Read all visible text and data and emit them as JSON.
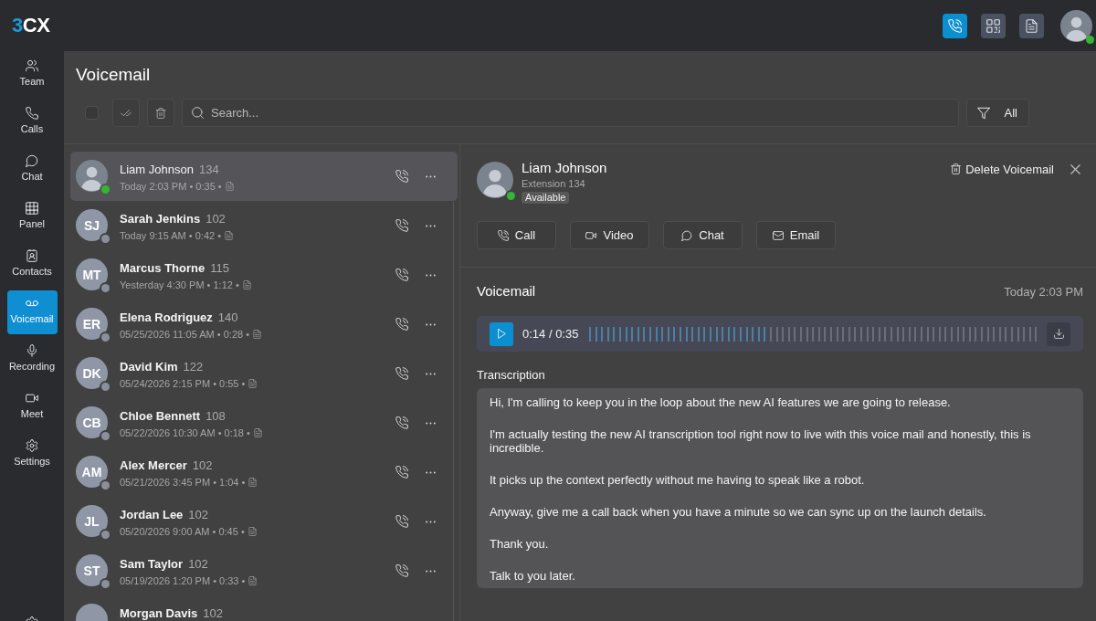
{
  "top_bar": {
    "logo": "3CX",
    "actions": [
      {
        "kind": "phone",
        "selected": true
      },
      {
        "kind": "qr",
        "selected": false
      },
      {
        "kind": "document",
        "selected": false
      }
    ],
    "user": {
      "color": "#33b633"
    }
  },
  "sidebar": {
    "items": [
      {
        "kind": "team",
        "label": "Team",
        "selected": false
      },
      {
        "kind": "calls",
        "label": "Calls",
        "selected": false
      },
      {
        "kind": "chat",
        "label": "Chat",
        "selected": false
      },
      {
        "kind": "panel",
        "label": "Panel",
        "selected": false
      },
      {
        "kind": "contacts",
        "label": "Contacts",
        "selected": false
      },
      {
        "kind": "voicemail",
        "label": "Voicemail",
        "selected": true
      },
      {
        "kind": "recording",
        "label": "Recording",
        "selected": false
      },
      {
        "kind": "meet",
        "label": "Meet",
        "selected": false
      },
      {
        "kind": "settings",
        "label": "Settings",
        "selected": false
      }
    ]
  },
  "page": {
    "title": "Voicemail"
  },
  "toolbar": {
    "select_all": {
      "checked": false
    },
    "search": {
      "placeholder": "Search..."
    },
    "filter": {
      "label": "All"
    }
  },
  "voicemails": [
    {
      "kind": "photo",
      "name": "Liam Johnson",
      "extension": "134",
      "meta": "Today 2:03 PM • 0:35 •",
      "selected": true,
      "unread": false,
      "color": "#33b633"
    },
    {
      "kind": "initials",
      "initials": "SJ",
      "name": "Sarah Jenkins",
      "extension": "102",
      "meta": "Today 9:15 AM • 0:42 •",
      "selected": false,
      "unread": true,
      "color": "#8a909b"
    },
    {
      "kind": "initials",
      "initials": "MT",
      "name": "Marcus Thorne",
      "extension": "115",
      "meta": "Yesterday 4:30 PM • 1:12 •",
      "selected": false,
      "unread": true,
      "color": "#8a909b"
    },
    {
      "kind": "initials",
      "initials": "ER",
      "name": "Elena Rodriguez",
      "extension": "140",
      "meta": "05/25/2026 11:05 AM • 0:28 •",
      "selected": false,
      "unread": true,
      "color": "#8a909b"
    },
    {
      "kind": "initials",
      "initials": "DK",
      "name": "David Kim",
      "extension": "122",
      "meta": "05/24/2026 2:15 PM • 0:55 •",
      "selected": false,
      "unread": true,
      "color": "#8a909b"
    },
    {
      "kind": "initials",
      "initials": "CB",
      "name": "Chloe Bennett",
      "extension": "108",
      "meta": "05/22/2026 10:30 AM • 0:18 •",
      "selected": false,
      "unread": true,
      "color": "#8a909b"
    },
    {
      "kind": "initials",
      "initials": "AM",
      "name": "Alex Mercer",
      "extension": "102",
      "meta": "05/21/2026 3:45 PM • 1:04 •",
      "selected": false,
      "unread": true,
      "color": "#8a909b"
    },
    {
      "kind": "initials",
      "initials": "JL",
      "name": "Jordan Lee",
      "extension": "102",
      "meta": "05/20/2026 9:00 AM • 0:45 •",
      "selected": false,
      "unread": true,
      "color": "#8a909b"
    },
    {
      "kind": "initials",
      "initials": "ST",
      "name": "Sam Taylor",
      "extension": "102",
      "meta": "05/19/2026 1:20 PM • 0:33 •",
      "selected": false,
      "unread": true,
      "color": "#8a909b"
    },
    {
      "kind": "initials",
      "name": "Morgan Davis",
      "extension": "102",
      "selected": false,
      "unread": true
    }
  ],
  "detail": {
    "name": "Liam Johnson",
    "extension": "Extension 134",
    "status": "Available",
    "color": "#33b633",
    "delete_label": "Delete Voicemail",
    "actions": [
      {
        "kind": "call",
        "label": "Call"
      },
      {
        "kind": "video",
        "label": "Video"
      },
      {
        "kind": "chat",
        "label": "Chat"
      },
      {
        "kind": "email",
        "label": "Email"
      }
    ]
  },
  "voicemail": {
    "title": "Voicemail",
    "time": "Today 2:03 PM",
    "player": {
      "position": "0:14 / 0:35",
      "level": 0.4
    },
    "transcription": {
      "label": "Transcription",
      "paragraphs": [
        "Hi, I'm calling to keep you in the loop about the new AI features we are going to release.",
        "I'm actually testing the new AI transcription tool right now to live with this voice mail and honestly, this is incredible.",
        "It picks up the context perfectly without me having to speak like a robot.",
        "Anyway, give me a call back when you have a minute so we can sync up on the launch details.",
        "Thank you.",
        "Talk to you later."
      ]
    }
  }
}
